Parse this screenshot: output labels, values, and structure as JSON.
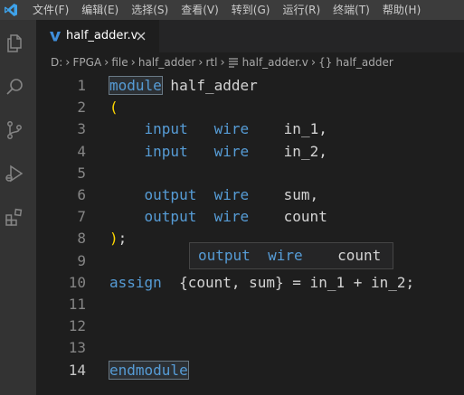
{
  "menubar": {
    "items": [
      "文件(F)",
      "编辑(E)",
      "选择(S)",
      "查看(V)",
      "转到(G)",
      "运行(R)",
      "终端(T)",
      "帮助(H)"
    ]
  },
  "activity_bar": {
    "icons": [
      "explorer-icon",
      "search-icon",
      "source-control-icon",
      "run-debug-icon",
      "extensions-icon"
    ]
  },
  "tab": {
    "title": "half_adder.v",
    "icon": "verilog-file-icon",
    "close_icon": "close-icon"
  },
  "breadcrumb": {
    "parts": [
      "D:",
      "FPGA",
      "file",
      "half_adder",
      "rtl",
      "half_adder.v",
      "half_adder"
    ],
    "symbol_prefix": "{}"
  },
  "editor": {
    "lines": [
      {
        "n": "1",
        "tokens": [
          {
            "t": "module",
            "c": "kw",
            "box": true
          },
          {
            "t": " half_adder",
            "c": "plain"
          }
        ]
      },
      {
        "n": "2",
        "tokens": [
          {
            "t": "(",
            "c": "paren"
          }
        ]
      },
      {
        "n": "3",
        "tokens": [
          {
            "t": "    input",
            "c": "kw"
          },
          {
            "t": "   ",
            "c": "plain"
          },
          {
            "t": "wire",
            "c": "kw"
          },
          {
            "t": "    in_1,",
            "c": "plain"
          }
        ]
      },
      {
        "n": "4",
        "tokens": [
          {
            "t": "    input",
            "c": "kw"
          },
          {
            "t": "   ",
            "c": "plain"
          },
          {
            "t": "wire",
            "c": "kw"
          },
          {
            "t": "    in_2,",
            "c": "plain"
          }
        ]
      },
      {
        "n": "5",
        "tokens": []
      },
      {
        "n": "6",
        "tokens": [
          {
            "t": "    output",
            "c": "kw"
          },
          {
            "t": "  ",
            "c": "plain"
          },
          {
            "t": "wire",
            "c": "kw"
          },
          {
            "t": "    sum,",
            "c": "plain"
          }
        ]
      },
      {
        "n": "7",
        "tokens": [
          {
            "t": "    output",
            "c": "kw"
          },
          {
            "t": "  ",
            "c": "plain"
          },
          {
            "t": "wire",
            "c": "kw"
          },
          {
            "t": "    count",
            "c": "plain"
          }
        ]
      },
      {
        "n": "8",
        "tokens": [
          {
            "t": ")",
            "c": "paren"
          },
          {
            "t": ";",
            "c": "plain"
          }
        ]
      },
      {
        "n": "9",
        "tokens": []
      },
      {
        "n": "10",
        "tokens": [
          {
            "t": "assign",
            "c": "kw"
          },
          {
            "t": "  {count, sum} = in_1 + in_2;",
            "c": "plain"
          }
        ]
      },
      {
        "n": "11",
        "tokens": []
      },
      {
        "n": "12",
        "tokens": []
      },
      {
        "n": "13",
        "tokens": []
      },
      {
        "n": "14",
        "tokens": [
          {
            "t": "endmodule",
            "c": "kw",
            "box": true
          }
        ],
        "active": true
      }
    ]
  },
  "hover_tooltip": {
    "tokens": [
      {
        "t": "output",
        "c": "kw"
      },
      {
        "t": "  ",
        "c": "plain"
      },
      {
        "t": "wire",
        "c": "kw"
      },
      {
        "t": "    count",
        "c": "plain"
      }
    ]
  },
  "colors": {
    "keyword": "#569cd6",
    "text": "#d4d4d4",
    "bracket": "#ffd700",
    "line_number": "#858585",
    "background": "#1e1e1e"
  }
}
